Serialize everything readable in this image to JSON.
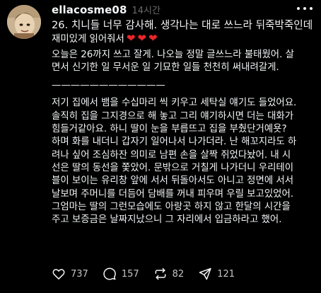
{
  "post": {
    "username": "ellacosme08",
    "time": "14시간",
    "lines": [
      "26. 치니들 너무 감사해. 생각나는 대로 쓰느라 뒤죽박죽인데",
      "재미있게 읽어줘서",
      "오늘은 26까지 쓰고 잘게. 나오늘 정말 글쓰느라 불태웠어. 살",
      "면서 신기한 일 무서운 일 기묘한 일들 천천히 써내려갈게.",
      "————————————",
      "저기 집에서 뱀을 수십마리 씩 키우고 세탁실 얘기도 들었어요.",
      "솔직히 집을 그지경으로 해 놓고 그리 얘기하시면 더는 대화가",
      "힘들거같아요. 하니 딸이 눈을 부릅뜨고  집을 부췄단거예욧?",
      "하며 화를 내더니 갑자기 일어나서 나가더라. 난 해꼬지라도 하",
      "려나 싶어 조심하잔 의미로 남편 손을 살짝 쥐었다놨어. 내 시",
      "선은 딸의 동선을 쫓았어. 문밖으로 거칠게 나가더니 우리테이",
      "블이 보이는 유리창 앞에 서서 뒤돌아서도 아니고 정면에 서서",
      "날보며 주머니를 더듬어 담배를 꺼내 피우며 우릴 보고있었어.",
      "그엄마는 딸의 그런모습에도 아랑곳 하지 않고 한달의 시간을",
      "주고 보증금은 날짜지났으니 그 자리에서 입금하라고 했어."
    ],
    "hearts": [
      "❤",
      "❤",
      "❤"
    ],
    "stats": {
      "likes": "737",
      "comments": "157",
      "reposts": "82",
      "shares": "121"
    }
  },
  "colors": {
    "background": "#000000",
    "text": "#f3f5f7",
    "muted": "#6b6b6b",
    "heart": "#e8262b"
  },
  "icons": [
    "avatar-photo",
    "more-icon",
    "heart-icon",
    "comment-icon",
    "repost-icon",
    "share-icon"
  ]
}
